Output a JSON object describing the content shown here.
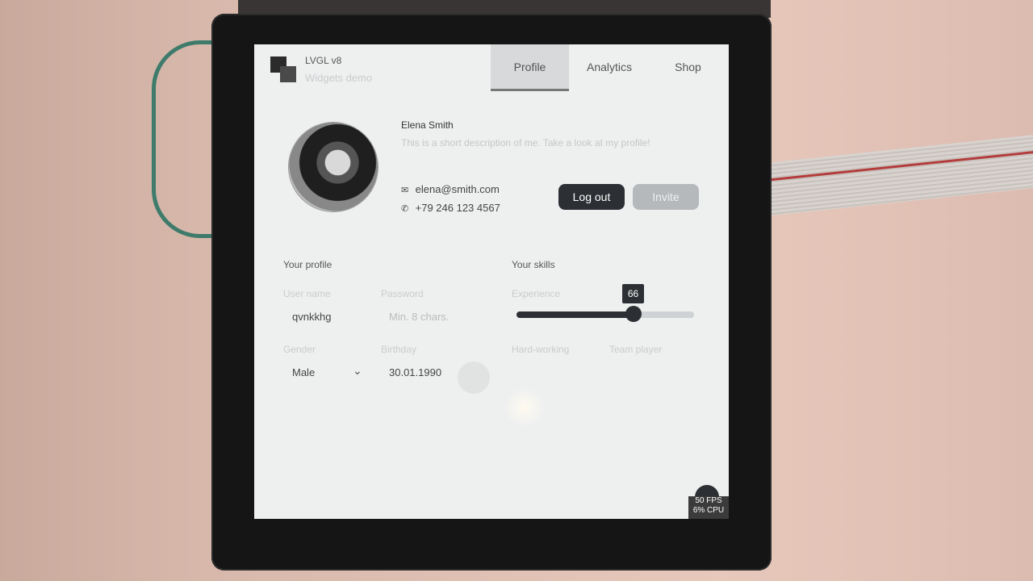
{
  "header": {
    "app_title": "LVGL v8",
    "app_subtitle": "Widgets demo",
    "tabs": [
      {
        "label": "Profile",
        "active": true
      },
      {
        "label": "Analytics",
        "active": false
      },
      {
        "label": "Shop",
        "active": false
      }
    ]
  },
  "profile": {
    "name": "Elena Smith",
    "description": "This is a short description of me. Take a look at my profile!",
    "email": "elena@smith.com",
    "phone": "+79 246 123 4567",
    "logout_label": "Log out",
    "invite_label": "Invite"
  },
  "your_profile": {
    "title": "Your profile",
    "username_label": "User name",
    "username_value": "qvnkkhg",
    "password_label": "Password",
    "password_placeholder": "Min. 8 chars.",
    "gender_label": "Gender",
    "gender_value": "Male",
    "birthday_label": "Birthday",
    "birthday_value": "30.01.1990"
  },
  "your_skills": {
    "title": "Your skills",
    "experience_label": "Experience",
    "experience_value": "66",
    "experience_fraction": 0.66,
    "hardworking_label": "Hard-working",
    "teamplayer_label": "Team player"
  },
  "perf": {
    "fps": "50 FPS",
    "cpu": "6% CPU"
  },
  "colors": {
    "accent": "#2c2f33",
    "screen_bg": "#eef0f0"
  }
}
